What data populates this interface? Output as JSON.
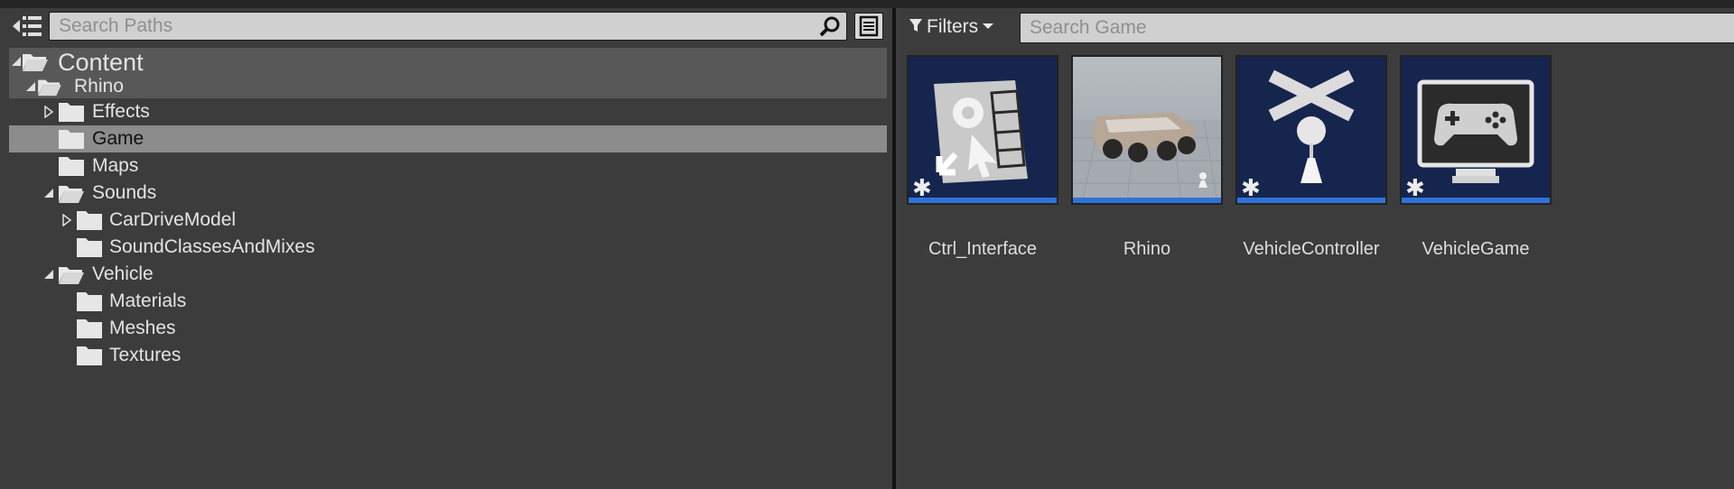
{
  "left_panel": {
    "search": {
      "placeholder": "Search Paths",
      "value": ""
    },
    "tree": [
      {
        "label": "Content",
        "expanded": true
      },
      {
        "label": "Rhino",
        "expanded": true
      },
      {
        "label": "Effects",
        "expanded": false
      },
      {
        "label": "Game",
        "selected": true
      },
      {
        "label": "Maps"
      },
      {
        "label": "Sounds",
        "expanded": true
      },
      {
        "label": "CarDriveModel",
        "expanded": false
      },
      {
        "label": "SoundClassesAndMixes"
      },
      {
        "label": "Vehicle",
        "expanded": true
      },
      {
        "label": "Materials"
      },
      {
        "label": "Meshes"
      },
      {
        "label": "Textures"
      }
    ]
  },
  "right_panel": {
    "filters_label": "Filters",
    "search": {
      "placeholder": "Search Game",
      "value": ""
    },
    "assets": [
      {
        "name": "Ctrl_Interface",
        "thumbnail": "map-settings-icon",
        "new": true
      },
      {
        "name": "Rhino",
        "thumbnail": "vehicle-render-preview",
        "new": false
      },
      {
        "name": "VehicleController",
        "thumbnail": "controller-pawn-icon",
        "new": true
      },
      {
        "name": "VehicleGame",
        "thumbnail": "gamepad-monitor-icon",
        "new": true
      }
    ]
  },
  "colors": {
    "panel_bg": "#3c3c3c",
    "selection_dark": "#585858",
    "selection_light": "#8c8c8c",
    "thumb_bg": "#15254d",
    "accent_bar": "#2f73d8"
  }
}
